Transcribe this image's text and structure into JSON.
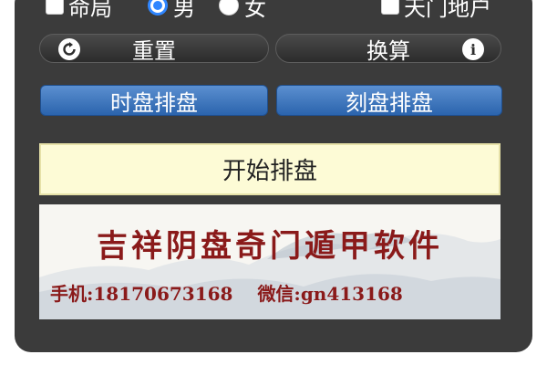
{
  "options": {
    "ming_ju": "命局",
    "male": "男",
    "female": "女",
    "tian_men_di_hu": "天门地户",
    "selected_gender": "男"
  },
  "buttons": {
    "reset": "重置",
    "convert": "换算",
    "convert_icon": "i",
    "shi_pan": "时盘排盘",
    "ke_pan": "刻盘排盘",
    "start": "开始排盘"
  },
  "banner": {
    "title": "吉祥阴盘奇门遁甲软件",
    "phone": "手机:18170673168",
    "wechat": "微信:gn413168"
  },
  "colors": {
    "panel": "#3b3b3b",
    "accent_blue": "#2f86ff",
    "button_blue": "#2b64ad",
    "start_bg": "#fdfbd6",
    "banner_text": "#8a1a1a"
  },
  "icons": {
    "reset": "refresh-icon",
    "convert": "info-icon"
  }
}
